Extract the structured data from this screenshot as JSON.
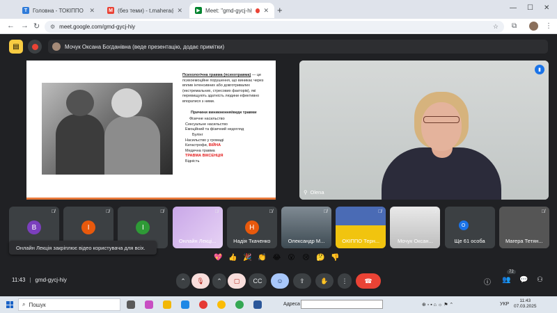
{
  "browser": {
    "tabs": [
      {
        "title": "Головна - ТОКІППО",
        "favicon": "T",
        "color": "#2f7bd9"
      },
      {
        "title": "(без теми) - t.mahera@ippo.e",
        "favicon": "M",
        "color": "#ea4335"
      },
      {
        "title": "Meet: \"gmd-gycj-hiy\"",
        "favicon": "▶",
        "color": "#00832d"
      }
    ],
    "url": "meet.google.com/gmd-gycj-hiy"
  },
  "meet": {
    "presenter_banner": "Мочук Оксана Богданівна (веде презентацію, додає примітки)",
    "slide": {
      "definition_bold": "Психологічна травма (психотравма)",
      "definition_rest": " — це психоемоційне порушення, що виникає через вплив інтенсивних або довготривалих (екстремальних, стресових факторів), які перевищують здатність людини ефективно впоратися з ними.",
      "subtitle": "Причини виникнення/види травми",
      "items": [
        {
          "text": "Фізичне насильство",
          "red": false
        },
        {
          "text": "Сексуальне насильство",
          "red": false
        },
        {
          "text": "Емоційний та фізичний недогляд",
          "red": false
        },
        {
          "text": "Булінг",
          "red": false
        },
        {
          "text": "Насильство у громаді",
          "red": false
        },
        {
          "text": "Катастрофи, ",
          "red": false,
          "suffix": "ВІЙНА"
        },
        {
          "text": "Медична травма",
          "red": false
        },
        {
          "text": "ТРАВМА ВІКСЕНЦІЯ",
          "red": true
        },
        {
          "text": "Бідність",
          "red": false
        }
      ]
    },
    "speaker_name": "Olena",
    "tiles": [
      {
        "type": "letter",
        "letter": "В",
        "color": "#7b3fbd",
        "name": ""
      },
      {
        "type": "letter",
        "letter": "І",
        "color": "#e8590c",
        "name": ""
      },
      {
        "type": "letter",
        "letter": "І",
        "color": "#2e9a36",
        "name": ""
      },
      {
        "type": "thumb",
        "name": "Онлайн Лекці..."
      },
      {
        "type": "letter",
        "letter": "Н",
        "color": "#e8590c",
        "name": "Надія Ткаченко"
      },
      {
        "type": "thumb",
        "name": "Олександр М..."
      },
      {
        "type": "thumb",
        "name": "ОКІППО Терн..."
      },
      {
        "type": "thumb",
        "name": "Мочук Оксан..."
      },
      {
        "type": "more",
        "name": "Ще 61 особа",
        "initial": "О"
      },
      {
        "type": "thumb",
        "name": "Магера Тетян..."
      }
    ],
    "toast": "Онлайн Лекція закріплює відео користувача для всіх.",
    "reactions": [
      "💖",
      "👍",
      "🎉",
      "👏",
      "😂",
      "😮",
      "😢",
      "🤔",
      "👎"
    ],
    "meeting_time": "11:43",
    "meeting_code": "gmd-gycj-hiy",
    "participants_count": "72"
  },
  "taskbar": {
    "search_placeholder": "Пошук",
    "address_label": "Адреса",
    "lang": "УКР",
    "time": "11:43",
    "date": "07.03.2025"
  },
  "colors": {
    "accent_yellow": "#f9cc42",
    "end_call": "#ea4335",
    "active_blue": "#a8c7fa"
  }
}
